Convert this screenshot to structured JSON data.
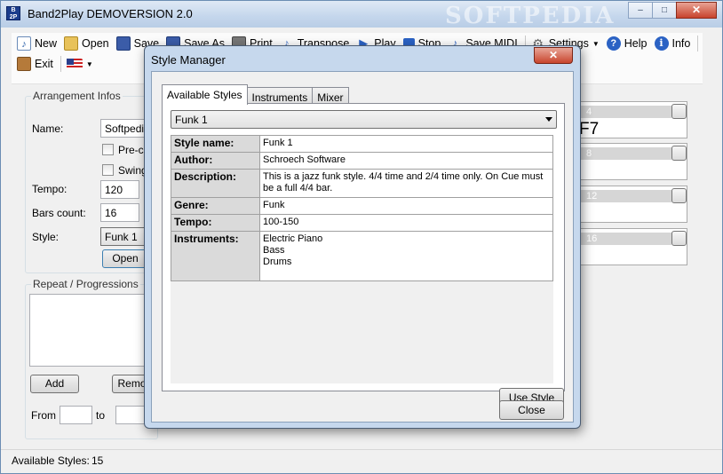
{
  "window": {
    "title": "Band2Play DEMOVERSION 2.0",
    "icon_text": "B\n2P",
    "watermark": "SOFTPEDIA",
    "minimize": "–",
    "maximize": "□",
    "close": "✕"
  },
  "toolbar": {
    "new": "New",
    "open": "Open",
    "save": "Save",
    "save_as": "Save As",
    "print": "Print",
    "transpose": "Transpose",
    "play": "Play",
    "stop": "Stop",
    "save_midi": "Save MIDI",
    "settings": "Settings",
    "help": "Help",
    "info": "Info",
    "exit": "Exit"
  },
  "arrangement": {
    "group_title": "Arrangement Infos",
    "name_label": "Name:",
    "name_value": "Softpedia",
    "precount_label": "Pre-co",
    "swing_label": "Swing",
    "tempo_label": "Tempo:",
    "tempo_value": "120",
    "bars_label": "Bars count:",
    "bars_value": "16",
    "style_label": "Style:",
    "style_value": "Funk 1",
    "open_button": "Open"
  },
  "repeat": {
    "group_title": "Repeat / Progressions",
    "add_button": "Add",
    "remove_button": "Remo",
    "from_label": "From",
    "to_label": "to"
  },
  "measures": [
    {
      "num": "4",
      "chord": "F7"
    },
    {
      "num": "8",
      "chord": ""
    },
    {
      "num": "12",
      "chord": ""
    },
    {
      "num": "16",
      "chord": ""
    }
  ],
  "status": {
    "label": "Available Styles:",
    "value": "15"
  },
  "dialog": {
    "title": "Style Manager",
    "close_x": "✕",
    "tabs": [
      "Available Styles",
      "Instruments",
      "Mixer"
    ],
    "selected_style": "Funk 1",
    "rows": [
      {
        "key": "Style name:",
        "value": "Funk 1"
      },
      {
        "key": "Author:",
        "value": "Schroech Software"
      },
      {
        "key": "Description:",
        "value": "This is a jazz funk style. 4/4 time and 2/4 time only. On Cue must be a full 4/4 bar."
      },
      {
        "key": "Genre:",
        "value": "Funk"
      },
      {
        "key": "Tempo:",
        "value": "100-150"
      },
      {
        "key": "Instruments:",
        "value": "Electric Piano\nBass\nDrums"
      }
    ],
    "use_style_button": "Use Style",
    "close_button": "Close"
  },
  "colors": {
    "titlebar": "#c4d6ec",
    "dialog_frame": "#c6d8ed",
    "close_red": "#c8452d"
  }
}
